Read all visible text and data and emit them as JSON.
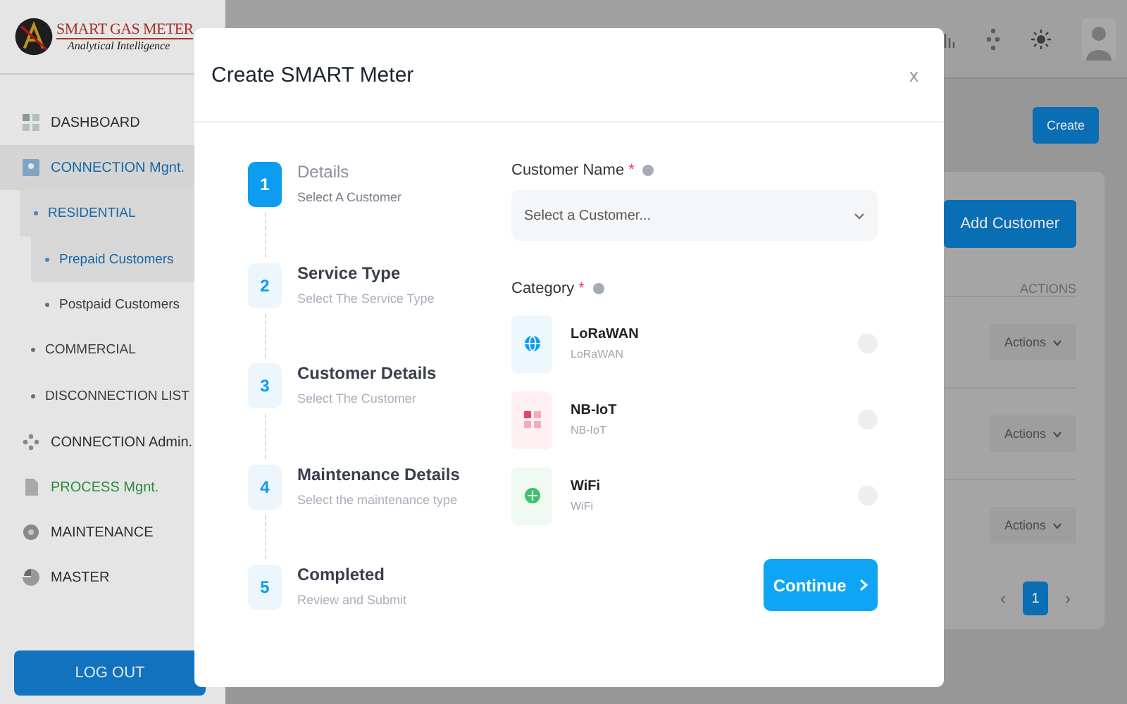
{
  "logo": {
    "title": "SMART GAS METER",
    "tagline": "Analytical Intelligence"
  },
  "sidebar": {
    "items": [
      {
        "label": "DASHBOARD",
        "selected": false
      },
      {
        "label": "CONNECTION Mgnt.",
        "selected": true,
        "children": [
          {
            "label": "RESIDENTIAL",
            "selected": true,
            "children": [
              {
                "label": "Prepaid Customers",
                "selected": true
              },
              {
                "label": "Postpaid Customers",
                "selected": false
              }
            ]
          },
          {
            "label": "COMMERCIAL",
            "selected": false
          },
          {
            "label": "DISCONNECTION LIST",
            "selected": false
          }
        ]
      },
      {
        "label": "CONNECTION Admin.",
        "selected": false
      },
      {
        "label": "PROCESS Mgnt.",
        "selected": false,
        "color": "#2e9b4b"
      },
      {
        "label": "MAINTENANCE",
        "selected": false
      },
      {
        "label": "MASTER",
        "selected": false
      }
    ],
    "logout": "LOG OUT"
  },
  "page": {
    "create_button": "Create",
    "add_customer_button": "Add Customer",
    "table": {
      "columns": [
        "ACTIONS"
      ],
      "rows": [
        {
          "action": "Actions"
        },
        {
          "action": "Actions"
        },
        {
          "action": "Actions"
        }
      ]
    },
    "pagination": {
      "prev": "‹",
      "pages": [
        {
          "label": "1",
          "selected": true
        }
      ],
      "next": "›"
    }
  },
  "modal": {
    "title": "Create SMART Meter",
    "close": "x",
    "steps": [
      {
        "number": "1",
        "title": "Details",
        "subtitle": "Select A Customer",
        "selected": true
      },
      {
        "number": "2",
        "title": "Service Type",
        "subtitle": "Select The Service Type",
        "selected": false
      },
      {
        "number": "3",
        "title": "Customer Details",
        "subtitle": "Select The Customer",
        "selected": false
      },
      {
        "number": "4",
        "title": "Maintenance Details",
        "subtitle": "Select the maintenance type",
        "selected": false
      },
      {
        "number": "5",
        "title": "Completed",
        "subtitle": "Review and Submit",
        "selected": false
      }
    ],
    "customer_field": {
      "label": "Customer Name",
      "required": "*",
      "placeholder": "Select a Customer..."
    },
    "category": {
      "label": "Category",
      "required": "*",
      "options": [
        {
          "title": "LoRaWAN",
          "subtitle": "LoRaWAN",
          "color": "#0d9cf0",
          "selected": false
        },
        {
          "title": "NB-IoT",
          "subtitle": "NB-IoT",
          "color": "#f0406a",
          "selected": false
        },
        {
          "title": "WiFi",
          "subtitle": "WiFi",
          "color": "#3cc26b",
          "selected": false
        }
      ]
    },
    "continue_button": "Continue"
  }
}
